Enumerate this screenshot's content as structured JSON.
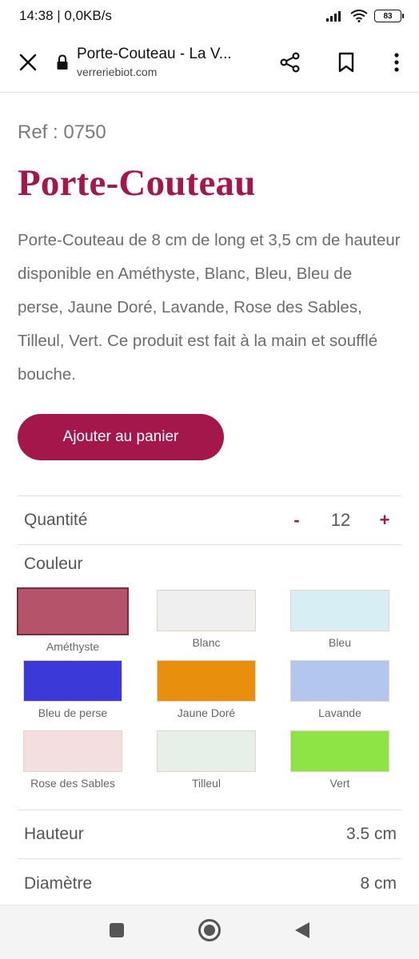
{
  "status_bar": {
    "time": "14:38 | 0,0KB/s",
    "battery": "83"
  },
  "toolbar": {
    "title": "Porte-Couteau - La V...",
    "domain": "verreriebiot.com",
    "icons": [
      "close-icon",
      "lock-icon",
      "share-icon",
      "bookmark-icon",
      "more-icon"
    ]
  },
  "product": {
    "ref": "Ref : 0750",
    "title": "Porte-Couteau",
    "description": "Porte-Couteau de 8 cm de long et 3,5 cm de hauteur disponible en Améthyste, Blanc, Bleu, Bleu de perse, Jaune Doré, Lavande, Rose des Sables, Tilleul, Vert. Ce produit est fait à la main et soufflé bouche.",
    "add_to_cart": "Ajouter au panier"
  },
  "quantity": {
    "label": "Quantité",
    "minus": "-",
    "value": "12",
    "plus": "+"
  },
  "colors": {
    "label": "Couleur",
    "items": [
      {
        "name": "Améthyste",
        "color": "#b5536a"
      },
      {
        "name": "Blanc",
        "color": "#efefef"
      },
      {
        "name": "Bleu",
        "color": "#d8eef5"
      },
      {
        "name": "Bleu de perse",
        "color": "#3b3ad8"
      },
      {
        "name": "Jaune Doré",
        "color": "#e8900e"
      },
      {
        "name": "Lavande",
        "color": "#b3c6ee"
      },
      {
        "name": "Rose des Sables",
        "color": "#f3dfe0"
      },
      {
        "name": "Tilleul",
        "color": "#e6efe8"
      },
      {
        "name": "Vert",
        "color": "#8fe445"
      }
    ]
  },
  "specs": {
    "hauteur_label": "Hauteur",
    "hauteur_value": "3.5 cm",
    "diametre_label": "Diamètre",
    "diametre_value": "8 cm"
  },
  "theme": {
    "accent": "#a3174a"
  },
  "navbar": {
    "icons": [
      "recents-square-icon",
      "home-circle-icon",
      "back-triangle-icon"
    ]
  }
}
